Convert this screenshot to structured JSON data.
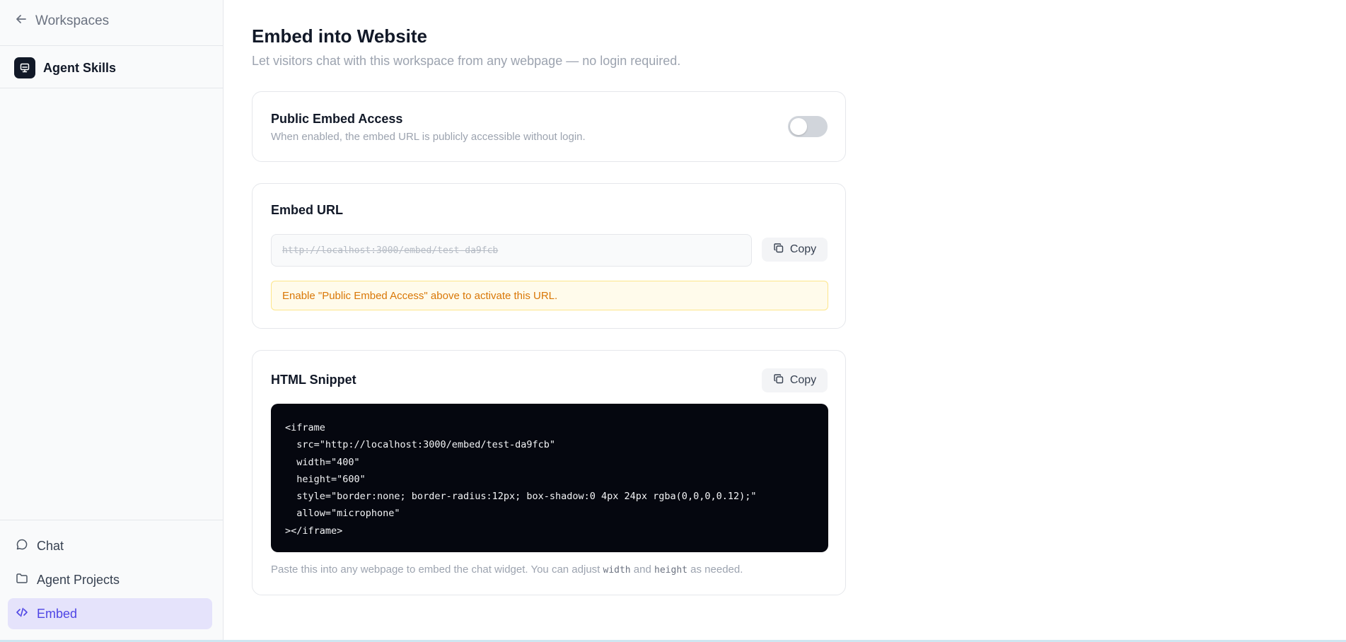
{
  "sidebar": {
    "back_label": "Workspaces",
    "workspace_name": "Agent Skills",
    "nav": [
      {
        "label": "Chat",
        "icon": "chat-bubble-icon"
      },
      {
        "label": "Agent Projects",
        "icon": "folder-icon"
      },
      {
        "label": "Embed",
        "icon": "code-icon",
        "active": true
      }
    ]
  },
  "page": {
    "title": "Embed into Website",
    "subtitle": "Let visitors chat with this workspace from any webpage — no login required."
  },
  "public_access": {
    "title": "Public Embed Access",
    "description": "When enabled, the embed URL is publicly accessible without login.",
    "enabled": false
  },
  "embed_url": {
    "title": "Embed URL",
    "value": "http://localhost:3000/embed/test-da9fcb",
    "copy_label": "Copy",
    "warning": "Enable \"Public Embed Access\" above to activate this URL."
  },
  "snippet": {
    "title": "HTML Snippet",
    "copy_label": "Copy",
    "lines": [
      "<iframe",
      "  src=\"http://localhost:3000/embed/test-da9fcb\"",
      "  width=\"400\"",
      "  height=\"600\"",
      "  style=\"border:none; border-radius:12px; box-shadow:0 4px 24px rgba(0,0,0,0.12);\"",
      "  allow=\"microphone\"",
      "></iframe>"
    ],
    "footer_before": "Paste this into any webpage to embed the chat widget. You can adjust ",
    "footer_code1": "width",
    "footer_and": " and ",
    "footer_code2": "height",
    "footer_after": " as needed."
  },
  "colors": {
    "accent": "#4f46e5",
    "active_bg": "#e5e3fb",
    "warning_text": "#d97706",
    "code_bg": "#05070f"
  }
}
